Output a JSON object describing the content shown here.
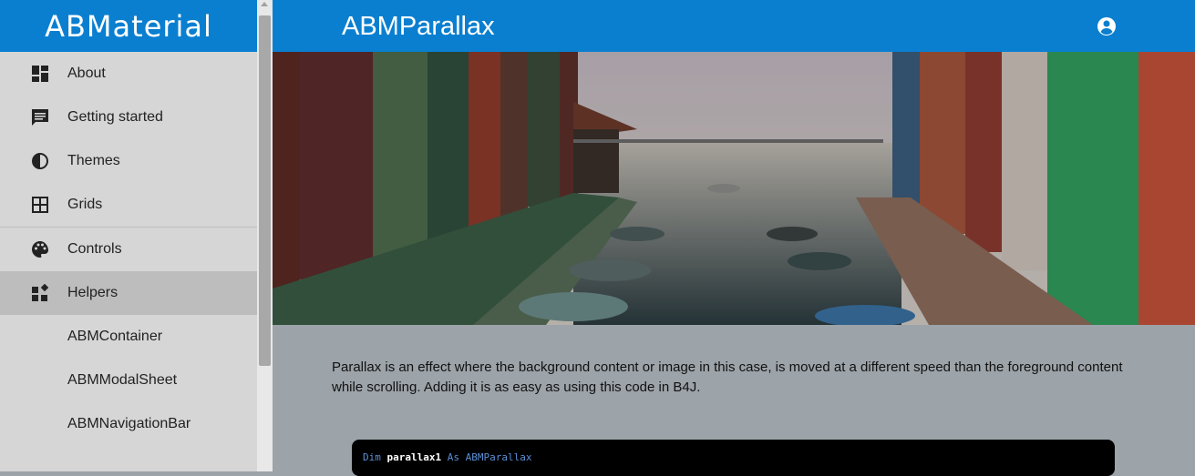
{
  "sidebar": {
    "logo": "ABMaterial",
    "items": [
      {
        "label": "About",
        "icon": "dashboard-icon"
      },
      {
        "label": "Getting started",
        "icon": "chat-icon"
      },
      {
        "label": "Themes",
        "icon": "contrast-icon"
      },
      {
        "label": "Grids",
        "icon": "grid-icon"
      },
      {
        "label": "Controls",
        "icon": "palette-icon"
      },
      {
        "label": "Helpers",
        "icon": "widgets-icon",
        "active": true
      }
    ],
    "subitems": [
      {
        "label": "ABMContainer"
      },
      {
        "label": "ABMModalSheet"
      },
      {
        "label": "ABMNavigationBar"
      }
    ]
  },
  "header": {
    "title": "ABMParallax",
    "account_icon": "account-circle-icon"
  },
  "content": {
    "description": "Parallax is an effect where the background content or image in this case, is moved at a different speed than the foreground content while scrolling. Adding it is as easy as using this code in B4J.",
    "code": {
      "kw_dim": "Dim",
      "identifier": "parallax1",
      "kw_as": "As",
      "type": "ABMParallax"
    }
  },
  "colors": {
    "accent": "#0a7fd0",
    "sidebar_bg": "#d6d6d6",
    "active_bg": "#bdbdbd",
    "content_bg": "#9ca3a9"
  }
}
